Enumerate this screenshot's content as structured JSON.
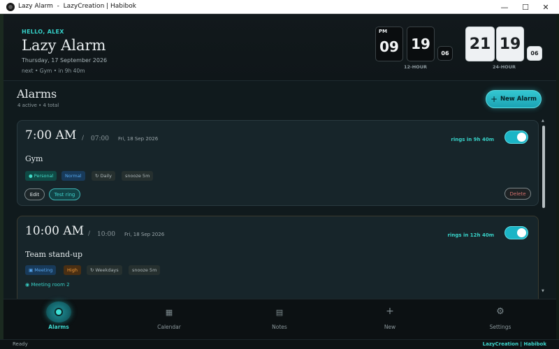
{
  "window": {
    "title": "Lazy Alarm  -  LazyCreation | Habibok",
    "minimize_glyph": "—",
    "maximize_glyph": "☐",
    "close_glyph": "✕"
  },
  "header": {
    "greeting": "HELLO, ALEX",
    "app_title": "Lazy Alarm",
    "date": "Thursday, 17 September 2026",
    "next": "next  •  Gym  •  in 9h 40m"
  },
  "clock12": {
    "ampm": "PM",
    "hours": "09",
    "minutes": "19",
    "seconds": "06",
    "label": "12-HOUR"
  },
  "clock24": {
    "hours": "21",
    "minutes": "19",
    "seconds": "06",
    "label": "24-HOUR"
  },
  "alarms_section": {
    "title": "Alarms",
    "subtitle": "4 active  •  4 total",
    "new_button_plus": "+",
    "new_button_label": "New Alarm"
  },
  "alarms": [
    {
      "time": "7:00 AM",
      "slash": "/",
      "time24": "07:00",
      "date": "Fri, 18 Sep 2026",
      "rings": "rings in 9h 40m",
      "enabled": true,
      "name": "Gym",
      "tags": [
        "● Personal",
        "Normal",
        "↻ Daily",
        "snooze 5m"
      ],
      "edit_label": "Edit",
      "test_label": "Test ring",
      "delete_label": "Delete"
    },
    {
      "time": "10:00 AM",
      "slash": "/",
      "time24": "10:00",
      "date": "Fri, 18 Sep 2026",
      "rings": "rings in 12h 40m",
      "enabled": true,
      "name": "Team stand-up",
      "tags": [
        "▣ Meeting",
        "High",
        "↻ Weekdays",
        "snooze 5m"
      ],
      "location": "◉ Meeting room 2"
    }
  ],
  "nav": [
    {
      "icon": "alarm-icon",
      "label": "Alarms",
      "active": true
    },
    {
      "icon": "calendar-icon",
      "glyph": "▦",
      "label": "Calendar"
    },
    {
      "icon": "notes-icon",
      "glyph": "▤",
      "label": "Notes"
    },
    {
      "icon": "plus-icon",
      "glyph": "+",
      "label": "New"
    },
    {
      "icon": "gear-icon",
      "glyph": "⚙",
      "label": "Settings"
    }
  ],
  "status": {
    "left": "Ready",
    "right": "LazyCreation | Habibok"
  },
  "colors": {
    "accent": "#35d0c8",
    "background": "#101a1d",
    "card": "#17252a",
    "high_priority": "#f29a38",
    "delete": "#d4716e"
  }
}
